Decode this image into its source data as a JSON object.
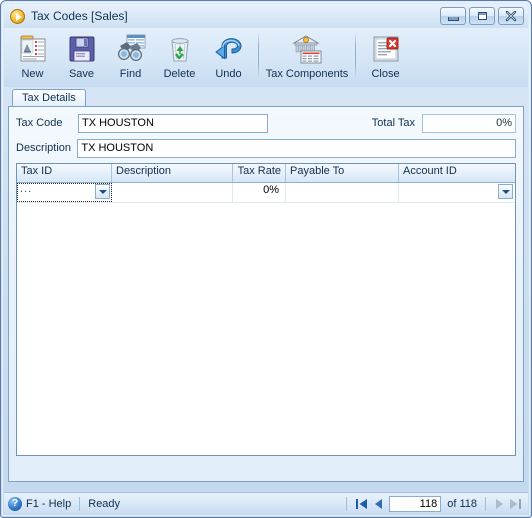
{
  "window": {
    "title": "Tax Codes [Sales]",
    "app_icon": "play-circle-icon",
    "caption_buttons": [
      {
        "name": "minimize-button",
        "glyph": "minimize-icon",
        "label": "Minimize"
      },
      {
        "name": "restore-button",
        "glyph": "restore-icon",
        "label": "Restore"
      },
      {
        "name": "close-window-button",
        "glyph": "close-x-icon",
        "label": "Close"
      }
    ]
  },
  "toolbar": {
    "items": [
      {
        "label": "New",
        "icon": "new-document-icon"
      },
      {
        "label": "Save",
        "icon": "floppy-disk-save-icon"
      },
      {
        "label": "Find",
        "icon": "binoculars-find-icon"
      },
      {
        "label": "Delete",
        "icon": "recycle-bin-delete-icon"
      },
      {
        "label": "Undo",
        "icon": "undo-arrow-icon"
      },
      {
        "label": "Tax Components",
        "icon": "bank-tax-components-icon"
      },
      {
        "label": "Close",
        "icon": "document-close-x-icon"
      }
    ]
  },
  "tabs": [
    {
      "label": "Tax Details",
      "active": true
    }
  ],
  "form": {
    "tax_code_label": "Tax Code",
    "tax_code_value": "TX HOUSTON",
    "tax_code_placeholder": "",
    "description_label": "Description",
    "description_value": "TX HOUSTON",
    "description_placeholder": "",
    "total_tax_label": "Total Tax",
    "total_tax_value": "0%"
  },
  "grid": {
    "columns": [
      {
        "key": "tax_id",
        "header": "Tax ID",
        "align": "left"
      },
      {
        "key": "description",
        "header": "Description",
        "align": "left"
      },
      {
        "key": "tax_rate",
        "header": "Tax Rate",
        "align": "right"
      },
      {
        "key": "payable_to",
        "header": "Payable To",
        "align": "left"
      },
      {
        "key": "account_id",
        "header": "Account ID",
        "align": "left"
      }
    ],
    "rows": [
      {
        "tax_id": "...",
        "description": "",
        "tax_rate": "0%",
        "payable_to": "",
        "account_id": "",
        "tax_id_dropdown": "chevron-down-icon",
        "account_id_dropdown": "chevron-down-icon"
      }
    ]
  },
  "statusbar": {
    "help_icon": "question-mark-icon",
    "help_text": "F1 - Help",
    "status_text": "Ready",
    "nav": {
      "first_label": "first-record",
      "prev_label": "previous-record",
      "next_label": "next-record",
      "last_label": "last-record",
      "record_value": "118",
      "of_text": "of  118"
    }
  },
  "colors": {
    "frame_border": "#5b7ca8",
    "title_text": "#12314f",
    "accent_blue": "#1c4f86",
    "nav_enabled": "#1d5ca8",
    "nav_disabled": "#9fb4c8",
    "panel_bg": "#eaf3fb"
  }
}
